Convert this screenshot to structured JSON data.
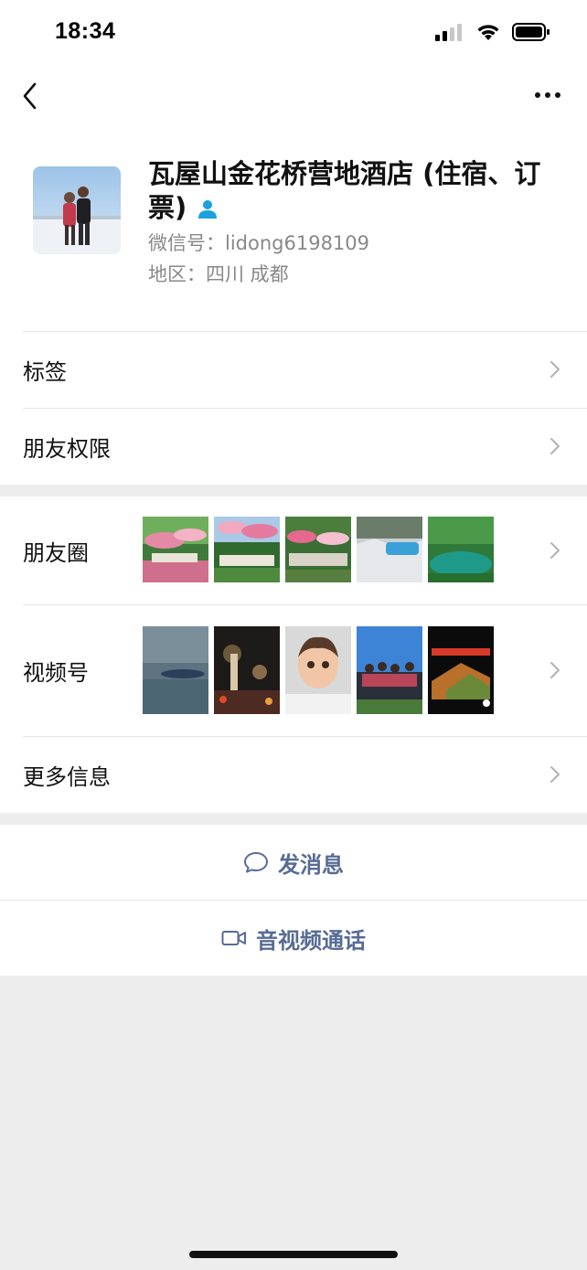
{
  "status": {
    "time": "18:34"
  },
  "profile": {
    "name": "瓦屋山金花桥营地酒店 (住宿、订票)",
    "wechat_id": "微信号：lidong6198109",
    "region": "地区：四川 成都"
  },
  "rows": {
    "tags": "标签",
    "friend_permissions": "朋友权限",
    "moments": "朋友圈",
    "channels": "视频号",
    "more_info": "更多信息"
  },
  "actions": {
    "send_message": "发消息",
    "av_call": "音视频通话"
  },
  "colors": {
    "link": "#576b95",
    "background": "#ededed",
    "verified": "#1aa1e0"
  }
}
